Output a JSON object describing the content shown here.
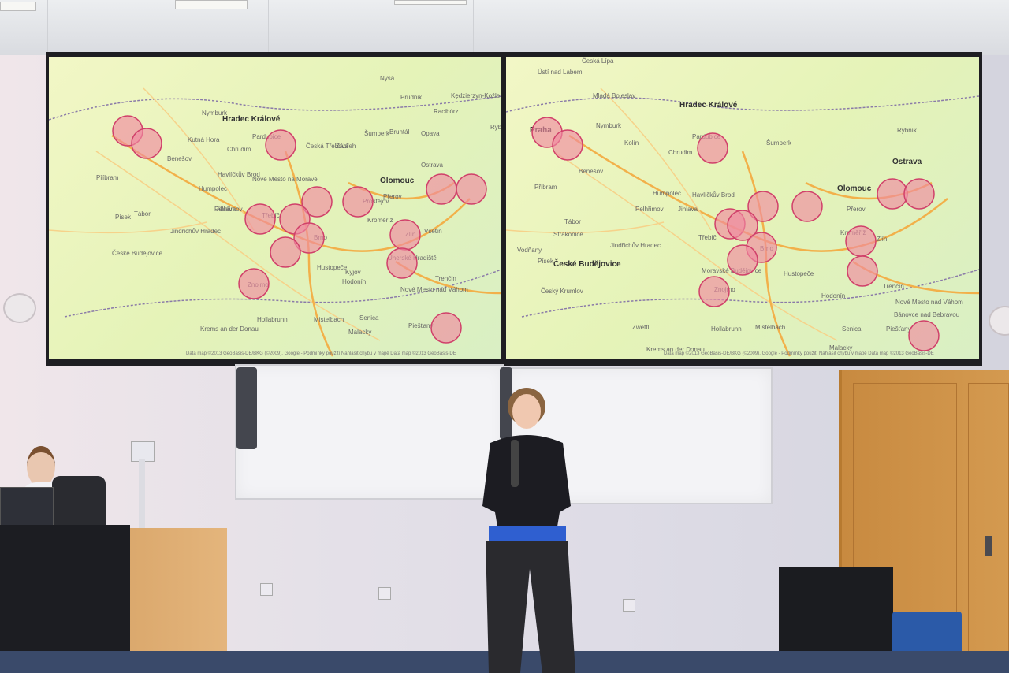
{
  "scene": {
    "description_label": "",
    "colors": {
      "map_background": "#e5f3b8",
      "marker_fill": "#f08aa0",
      "marker_stroke": "#d0406a",
      "road_major": "#f2b04a",
      "road_minor": "#f6d28a",
      "border": "#8a7aa8",
      "speaker_top": "#1c1c22",
      "speaker_shirt": "#2f5fd0",
      "door": "#cf9448"
    }
  },
  "maps": {
    "left": {
      "cities": [
        {
          "name": "Hradec Králové"
        },
        {
          "name": "Nymburk"
        },
        {
          "name": "Kutná Hora"
        },
        {
          "name": "Pardubice"
        },
        {
          "name": "Chrudim"
        },
        {
          "name": "Česká Třebová"
        },
        {
          "name": "Zábřeh"
        },
        {
          "name": "Šumperk"
        },
        {
          "name": "Bruntál"
        },
        {
          "name": "Opava"
        },
        {
          "name": "Ostrava"
        },
        {
          "name": "Olomouc"
        },
        {
          "name": "Přerov"
        },
        {
          "name": "Kroměříž"
        },
        {
          "name": "Zlín"
        },
        {
          "name": "Vsetín"
        },
        {
          "name": "Jihlava"
        },
        {
          "name": "Třebíč"
        },
        {
          "name": "Brno"
        },
        {
          "name": "Znojmo"
        },
        {
          "name": "Hodonín"
        },
        {
          "name": "České Budějovice"
        },
        {
          "name": "Tábor"
        },
        {
          "name": "Benešov"
        },
        {
          "name": "Příbram"
        },
        {
          "name": "Písek"
        },
        {
          "name": "Nové Město na Moravě"
        },
        {
          "name": "Havlíčkův Brod"
        },
        {
          "name": "Humpolec"
        },
        {
          "name": "Pelhřimov"
        },
        {
          "name": "Jindřichův Hradec"
        },
        {
          "name": "Trenčín"
        },
        {
          "name": "Nové Mesto nad Váhom"
        },
        {
          "name": "Senica"
        },
        {
          "name": "Piešťany"
        },
        {
          "name": "Mistelbach"
        },
        {
          "name": "Hollabrunn"
        },
        {
          "name": "Krems an der Donau"
        },
        {
          "name": "Malacky"
        },
        {
          "name": "Prostějov"
        },
        {
          "name": "Uherské Hradiště"
        },
        {
          "name": "Kyjov"
        },
        {
          "name": "Hustopeče"
        },
        {
          "name": "Rybník"
        },
        {
          "name": "Nysa"
        },
        {
          "name": "Prudnik"
        },
        {
          "name": "Racibórz"
        },
        {
          "name": "Kędzierzyn-Koźle"
        }
      ],
      "copyright": "Data map ©2013 GeoBasis-DE/BKG (©2009), Google - Podmínky použití  Nahlásit chybu v mapě  Data map ©2013 GeoBasis-DE"
    },
    "right": {
      "cities": [
        {
          "name": "Praha"
        },
        {
          "name": "Hradec Králové"
        },
        {
          "name": "Pardubice"
        },
        {
          "name": "Kolín"
        },
        {
          "name": "Chrudim"
        },
        {
          "name": "Olomouc"
        },
        {
          "name": "Ostrava"
        },
        {
          "name": "Přerov"
        },
        {
          "name": "Zlín"
        },
        {
          "name": "Jihlava"
        },
        {
          "name": "Třebíč"
        },
        {
          "name": "Brno"
        },
        {
          "name": "Znojmo"
        },
        {
          "name": "České Budějovice"
        },
        {
          "name": "Český Krumlov"
        },
        {
          "name": "Tábor"
        },
        {
          "name": "Strakonice"
        },
        {
          "name": "Vodňany"
        },
        {
          "name": "Písek"
        },
        {
          "name": "Havlíčkův Brod"
        },
        {
          "name": "Humpolec"
        },
        {
          "name": "Pelhřimov"
        },
        {
          "name": "Jindřichův Hradec"
        },
        {
          "name": "Moravské Budějovice"
        },
        {
          "name": "Hodonín"
        },
        {
          "name": "Kroměříž"
        },
        {
          "name": "Hustopeče"
        },
        {
          "name": "Hollabrunn"
        },
        {
          "name": "Mistelbach"
        },
        {
          "name": "Zwettl"
        },
        {
          "name": "Krems an der Donau"
        },
        {
          "name": "Senica"
        },
        {
          "name": "Trenčín"
        },
        {
          "name": "Nové Mesto nad Váhom"
        },
        {
          "name": "Bánovce nad Bebravou"
        },
        {
          "name": "Piešťany"
        },
        {
          "name": "Malacky"
        },
        {
          "name": "Benešov"
        },
        {
          "name": "Příbram"
        },
        {
          "name": "Nymburk"
        },
        {
          "name": "Mladá Boleslav"
        },
        {
          "name": "Ústí nad Labem"
        },
        {
          "name": "Česká Lípa"
        },
        {
          "name": "Rybník"
        },
        {
          "name": "Šumperk"
        }
      ],
      "copyright": "Data map ©2013 GeoBasis-DE/BKG (©2009), Google - Podmínky použití  Nahlásit chybu v mapě  Data map ©2013 GeoBasis-DE"
    }
  },
  "whiteboards": {
    "count": 2
  }
}
